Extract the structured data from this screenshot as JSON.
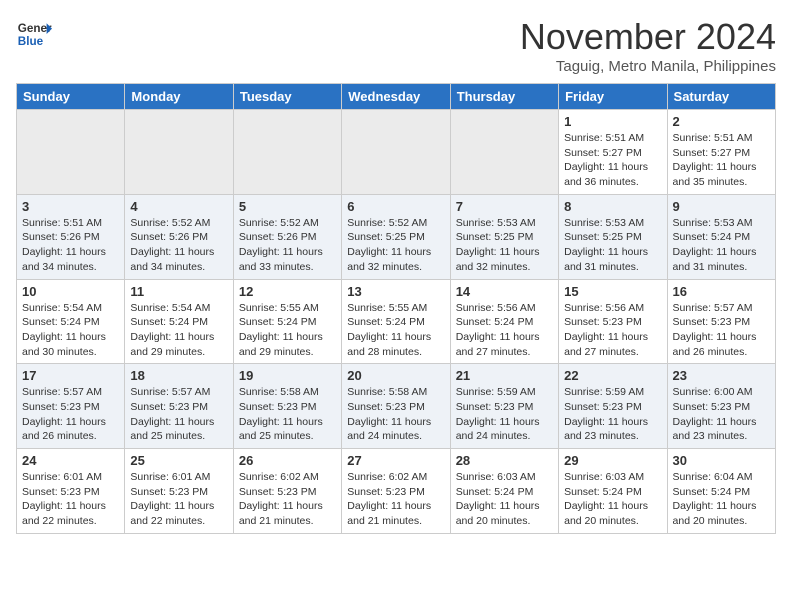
{
  "header": {
    "logo_line1": "General",
    "logo_line2": "Blue",
    "month": "November 2024",
    "location": "Taguig, Metro Manila, Philippines"
  },
  "weekdays": [
    "Sunday",
    "Monday",
    "Tuesday",
    "Wednesday",
    "Thursday",
    "Friday",
    "Saturday"
  ],
  "weeks": [
    [
      {
        "day": "",
        "info": ""
      },
      {
        "day": "",
        "info": ""
      },
      {
        "day": "",
        "info": ""
      },
      {
        "day": "",
        "info": ""
      },
      {
        "day": "",
        "info": ""
      },
      {
        "day": "1",
        "info": "Sunrise: 5:51 AM\nSunset: 5:27 PM\nDaylight: 11 hours\nand 36 minutes."
      },
      {
        "day": "2",
        "info": "Sunrise: 5:51 AM\nSunset: 5:27 PM\nDaylight: 11 hours\nand 35 minutes."
      }
    ],
    [
      {
        "day": "3",
        "info": "Sunrise: 5:51 AM\nSunset: 5:26 PM\nDaylight: 11 hours\nand 34 minutes."
      },
      {
        "day": "4",
        "info": "Sunrise: 5:52 AM\nSunset: 5:26 PM\nDaylight: 11 hours\nand 34 minutes."
      },
      {
        "day": "5",
        "info": "Sunrise: 5:52 AM\nSunset: 5:26 PM\nDaylight: 11 hours\nand 33 minutes."
      },
      {
        "day": "6",
        "info": "Sunrise: 5:52 AM\nSunset: 5:25 PM\nDaylight: 11 hours\nand 32 minutes."
      },
      {
        "day": "7",
        "info": "Sunrise: 5:53 AM\nSunset: 5:25 PM\nDaylight: 11 hours\nand 32 minutes."
      },
      {
        "day": "8",
        "info": "Sunrise: 5:53 AM\nSunset: 5:25 PM\nDaylight: 11 hours\nand 31 minutes."
      },
      {
        "day": "9",
        "info": "Sunrise: 5:53 AM\nSunset: 5:24 PM\nDaylight: 11 hours\nand 31 minutes."
      }
    ],
    [
      {
        "day": "10",
        "info": "Sunrise: 5:54 AM\nSunset: 5:24 PM\nDaylight: 11 hours\nand 30 minutes."
      },
      {
        "day": "11",
        "info": "Sunrise: 5:54 AM\nSunset: 5:24 PM\nDaylight: 11 hours\nand 29 minutes."
      },
      {
        "day": "12",
        "info": "Sunrise: 5:55 AM\nSunset: 5:24 PM\nDaylight: 11 hours\nand 29 minutes."
      },
      {
        "day": "13",
        "info": "Sunrise: 5:55 AM\nSunset: 5:24 PM\nDaylight: 11 hours\nand 28 minutes."
      },
      {
        "day": "14",
        "info": "Sunrise: 5:56 AM\nSunset: 5:24 PM\nDaylight: 11 hours\nand 27 minutes."
      },
      {
        "day": "15",
        "info": "Sunrise: 5:56 AM\nSunset: 5:23 PM\nDaylight: 11 hours\nand 27 minutes."
      },
      {
        "day": "16",
        "info": "Sunrise: 5:57 AM\nSunset: 5:23 PM\nDaylight: 11 hours\nand 26 minutes."
      }
    ],
    [
      {
        "day": "17",
        "info": "Sunrise: 5:57 AM\nSunset: 5:23 PM\nDaylight: 11 hours\nand 26 minutes."
      },
      {
        "day": "18",
        "info": "Sunrise: 5:57 AM\nSunset: 5:23 PM\nDaylight: 11 hours\nand 25 minutes."
      },
      {
        "day": "19",
        "info": "Sunrise: 5:58 AM\nSunset: 5:23 PM\nDaylight: 11 hours\nand 25 minutes."
      },
      {
        "day": "20",
        "info": "Sunrise: 5:58 AM\nSunset: 5:23 PM\nDaylight: 11 hours\nand 24 minutes."
      },
      {
        "day": "21",
        "info": "Sunrise: 5:59 AM\nSunset: 5:23 PM\nDaylight: 11 hours\nand 24 minutes."
      },
      {
        "day": "22",
        "info": "Sunrise: 5:59 AM\nSunset: 5:23 PM\nDaylight: 11 hours\nand 23 minutes."
      },
      {
        "day": "23",
        "info": "Sunrise: 6:00 AM\nSunset: 5:23 PM\nDaylight: 11 hours\nand 23 minutes."
      }
    ],
    [
      {
        "day": "24",
        "info": "Sunrise: 6:01 AM\nSunset: 5:23 PM\nDaylight: 11 hours\nand 22 minutes."
      },
      {
        "day": "25",
        "info": "Sunrise: 6:01 AM\nSunset: 5:23 PM\nDaylight: 11 hours\nand 22 minutes."
      },
      {
        "day": "26",
        "info": "Sunrise: 6:02 AM\nSunset: 5:23 PM\nDaylight: 11 hours\nand 21 minutes."
      },
      {
        "day": "27",
        "info": "Sunrise: 6:02 AM\nSunset: 5:23 PM\nDaylight: 11 hours\nand 21 minutes."
      },
      {
        "day": "28",
        "info": "Sunrise: 6:03 AM\nSunset: 5:24 PM\nDaylight: 11 hours\nand 20 minutes."
      },
      {
        "day": "29",
        "info": "Sunrise: 6:03 AM\nSunset: 5:24 PM\nDaylight: 11 hours\nand 20 minutes."
      },
      {
        "day": "30",
        "info": "Sunrise: 6:04 AM\nSunset: 5:24 PM\nDaylight: 11 hours\nand 20 minutes."
      }
    ]
  ]
}
